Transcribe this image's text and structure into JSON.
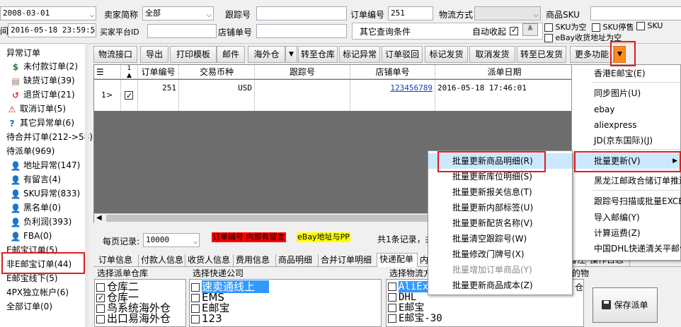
{
  "filters": {
    "date_from": "2008-03-01",
    "date_to_label": "间",
    "date_to": "2016-05-18 23:59:5",
    "seller_label": "卖家简称",
    "seller_value": "全部",
    "platform_label": "买家平台ID",
    "tracking_label": "跟踪号",
    "shop_order_label": "店铺单号",
    "order_no_label": "订单编号",
    "order_no_value": "251",
    "other_conditions": "其它查询条件",
    "logistics_label": "物流方式",
    "auto_collect_label": "自动收起",
    "sku_label": "商品SKU",
    "sku_empty": "SKU为空",
    "sku_stopped": "SKU停售",
    "sku_cut": "SKU",
    "ebay_addr": "eBay收货地址为空"
  },
  "tree": {
    "items": [
      {
        "label": "异常订单",
        "icon": "none"
      },
      {
        "label": "未付款订单(2)",
        "icon": "dollar-icon"
      },
      {
        "label": "缺货订单(39)",
        "icon": "box-icon"
      },
      {
        "label": "退货订单(21)",
        "icon": "return-icon"
      },
      {
        "label": "取消订单(5)",
        "icon": "warning-icon"
      },
      {
        "label": "其它异常单(6)",
        "icon": "question-icon"
      },
      {
        "label": "待合并订单(212->58)",
        "icon": "none"
      },
      {
        "label": "待派单(969)",
        "icon": "none"
      },
      {
        "label": "地址异常(147)",
        "icon": "user-icon"
      },
      {
        "label": "有留言(4)",
        "icon": "user-icon"
      },
      {
        "label": "SKU异常(833)",
        "icon": "user-icon"
      },
      {
        "label": "黑名单(0)",
        "icon": "user-icon"
      },
      {
        "label": "负利润(393)",
        "icon": "user-icon"
      },
      {
        "label": "FBA(0)",
        "icon": "user-icon"
      },
      {
        "label": "E邮宝订单(5)",
        "icon": "none"
      },
      {
        "label": "非E邮宝订单(44)",
        "icon": "none"
      },
      {
        "label": "E邮宝线下(5)",
        "icon": "none"
      },
      {
        "label": "4PX独立帐户(6)",
        "icon": "none"
      },
      {
        "label": "全部订单(0)",
        "icon": "none"
      }
    ]
  },
  "toolbar": {
    "buttons": [
      "物流接口",
      "导出",
      "打印模板",
      "邮件",
      "海外仓",
      "转至仓库",
      "标记异常",
      "订单驳回",
      "标记发货",
      "取消发货",
      "转至已发货",
      "更多功能"
    ]
  },
  "grid": {
    "columns": [
      "",
      "订单编号",
      "交易币种",
      "跟踪号",
      "店铺单号",
      "派单日期"
    ],
    "sort_marker": "1",
    "row": {
      "num": "1>",
      "order_no": "251",
      "currency": "USD",
      "tracking": "",
      "shop_order": "123456789",
      "date": "2016-05-18 17:46:01"
    }
  },
  "pager": {
    "per_page_label": "每页记录:",
    "per_page_value": "10000",
    "legend_red": "订单编号 内部有留言",
    "legend_yellow": "eBay地址与PP",
    "summary": "共1条记录，共"
  },
  "tabs": [
    "订单信息",
    "付款人信息",
    "收货人信息",
    "费用信息",
    "商品明细",
    "合并订单明细",
    "快递配单",
    "内",
    "备注",
    "操作日志"
  ],
  "panels": {
    "warehouse_title": "选择派单仓库",
    "warehouses": [
      {
        "label": "仓库二",
        "checked": false
      },
      {
        "label": "仓库一",
        "checked": true
      },
      {
        "label": "鸟系统海外仓",
        "checked": false
      },
      {
        "label": "出口易海外仓",
        "checked": false
      }
    ],
    "express_title": "选择快递公司",
    "express": [
      {
        "label": "速卖通线上",
        "selected": true
      },
      {
        "label": "EMS",
        "selected": false
      },
      {
        "label": "E邮宝",
        "selected": false
      },
      {
        "label": "123",
        "selected": false
      }
    ],
    "logistics_title": "选择物流方",
    "logistics": [
      {
        "label": "AliEx",
        "selected": true
      },
      {
        "label": "DHL",
        "selected": false
      },
      {
        "label": "E邮宝",
        "selected": false
      },
      {
        "label": "E邮宝-30",
        "selected": false
      }
    ],
    "right_cut_1": "的物",
    "right_cut_2": "仓",
    "save_label": "保存派单"
  },
  "more_menu": {
    "items": [
      {
        "label": "香港E邮宝(E)"
      },
      {
        "label": "同步图片(U)"
      },
      {
        "label": "ebay"
      },
      {
        "label": "aliexpress"
      },
      {
        "label": "JD(京东国际)(J)"
      },
      {
        "label": "批量更新(V)"
      },
      {
        "label": "黑龙江邮政合储订单推送"
      },
      {
        "label": "跟踪号扫描或批量EXCEL"
      },
      {
        "label": "导入邮编(Y)"
      },
      {
        "label": "计算运费(Z)"
      },
      {
        "label": "中国DHL快递清关平邮件"
      }
    ]
  },
  "submenu": {
    "items": [
      {
        "label": "批量更新商品明细(R)",
        "disabled": false
      },
      {
        "label": "批量更新库位明细(S)",
        "disabled": false
      },
      {
        "label": "批量更新报关信息(T)",
        "disabled": false
      },
      {
        "label": "批量更新内部标签(U)",
        "disabled": false
      },
      {
        "label": "批量更新配货名称(V)",
        "disabled": false
      },
      {
        "label": "批量清空跟踪号(W)",
        "disabled": false
      },
      {
        "label": "批量修改门牌号(X)",
        "disabled": false
      },
      {
        "label": "批量增加订单商品(Y)",
        "disabled": true
      },
      {
        "label": "批量更新商品成本(Z)",
        "disabled": false
      }
    ]
  },
  "colors": {
    "highlight_box": "#e01c1c",
    "menu_hover": "#cce8ff",
    "express_selected": "#3399ff",
    "dropdown_orange": "#ff8c1a"
  }
}
